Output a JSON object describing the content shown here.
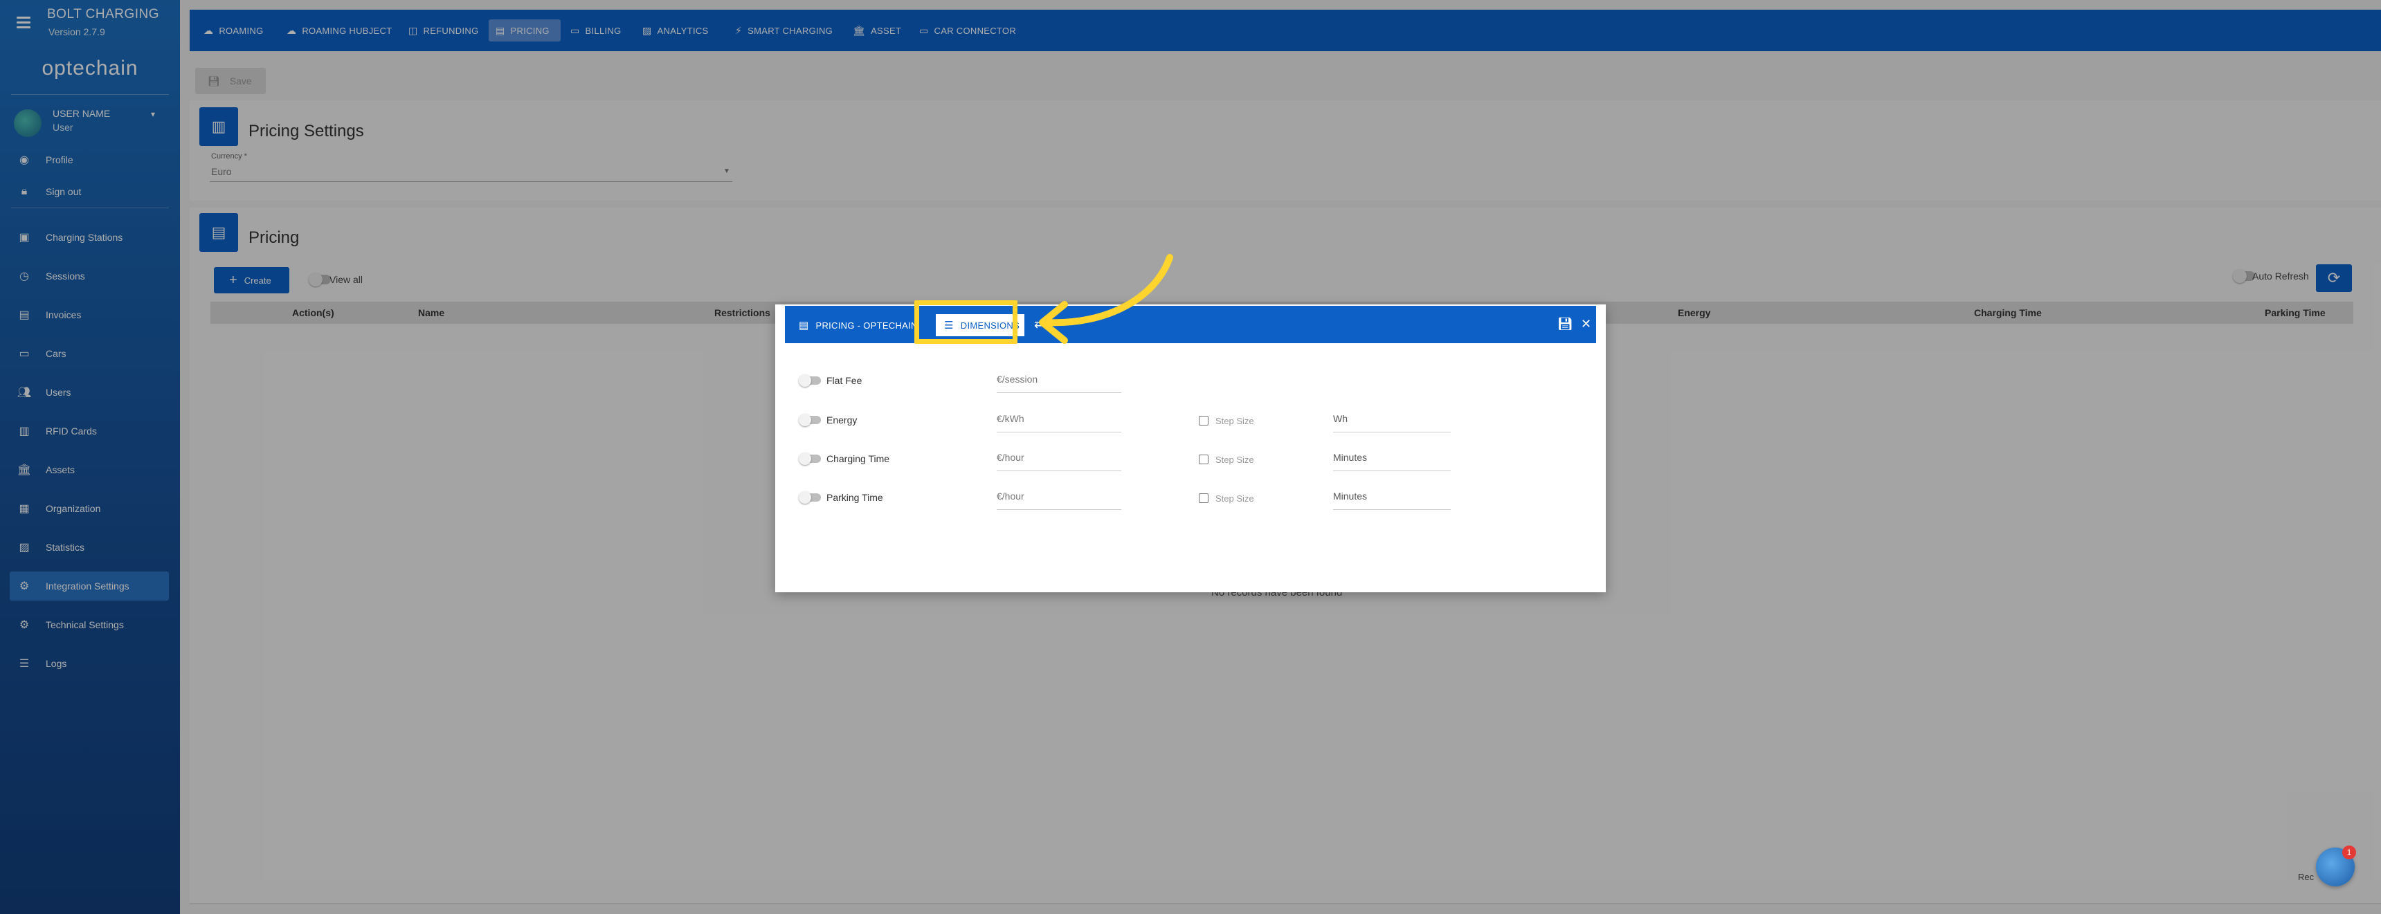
{
  "app": {
    "title": "BOLT CHARGING",
    "version": "Version 2.7.9",
    "logo": "optechain"
  },
  "user": {
    "name": "USER NAME",
    "role": "User",
    "caret": "▾"
  },
  "sidebar": {
    "account_items": [
      {
        "label": "Profile",
        "icon": "account-icon"
      },
      {
        "label": "Sign out",
        "icon": "lock-icon"
      }
    ],
    "items": [
      {
        "label": "Charging Stations",
        "icon": "ev-station-icon"
      },
      {
        "label": "Sessions",
        "icon": "history-icon"
      },
      {
        "label": "Invoices",
        "icon": "invoice-icon"
      },
      {
        "label": "Cars",
        "icon": "car-icon"
      },
      {
        "label": "Users",
        "icon": "users-icon"
      },
      {
        "label": "RFID Cards",
        "icon": "badge-icon"
      },
      {
        "label": "Assets",
        "icon": "bank-icon"
      },
      {
        "label": "Organization",
        "icon": "domain-icon"
      },
      {
        "label": "Statistics",
        "icon": "chart-icon"
      },
      {
        "label": "Integration Settings",
        "icon": "gear-icon",
        "active": true
      },
      {
        "label": "Technical Settings",
        "icon": "settings-box-icon"
      },
      {
        "label": "Logs",
        "icon": "list-icon"
      }
    ]
  },
  "topbar": {
    "tabs": [
      {
        "label": "ROAMING",
        "icon": "cloud-icon"
      },
      {
        "label": "ROAMING HUBJECT",
        "icon": "cloud-icon"
      },
      {
        "label": "REFUNDING",
        "icon": "refund-icon"
      },
      {
        "label": "PRICING",
        "icon": "pricing-icon",
        "active": true
      },
      {
        "label": "BILLING",
        "icon": "credit-card-icon"
      },
      {
        "label": "ANALYTICS",
        "icon": "analytics-icon"
      },
      {
        "label": "SMART CHARGING",
        "icon": "bolt-icon"
      },
      {
        "label": "ASSET",
        "icon": "bank-icon"
      },
      {
        "label": "CAR CONNECTOR",
        "icon": "car-icon"
      }
    ]
  },
  "toolbar": {
    "save_label": "Save"
  },
  "pricing_settings": {
    "title": "Pricing Settings",
    "currency_label": "Currency *",
    "currency_value": "Euro"
  },
  "pricing": {
    "title": "Pricing",
    "create_label": "Create",
    "view_all_label": "View all",
    "auto_refresh_label": "Auto Refresh",
    "columns": {
      "actions": "Action(s)",
      "name": "Name",
      "restrictions": "Restrictions",
      "energy": "Energy",
      "charging_time": "Charging Time",
      "parking_time": "Parking Time"
    },
    "empty_message": "No records have been found",
    "records_label": "Rec"
  },
  "dialog": {
    "tab_main": "PRICING - OPTECHAIN",
    "tab_dimensions": "DIMENSIONS",
    "rows": [
      {
        "label": "Flat Fee",
        "placeholder": "€/session",
        "has_step": false
      },
      {
        "label": "Energy",
        "placeholder": "€/kWh",
        "has_step": true,
        "step_label": "Step Size",
        "unit": "Wh"
      },
      {
        "label": "Charging Time",
        "placeholder": "€/hour",
        "has_step": true,
        "step_label": "Step Size",
        "unit": "Minutes"
      },
      {
        "label": "Parking Time",
        "placeholder": "€/hour",
        "has_step": true,
        "step_label": "Step Size",
        "unit": "Minutes"
      }
    ]
  },
  "chat": {
    "badge_count": "1"
  },
  "colors": {
    "primary": "#0d61c6",
    "highlight": "#ffd42e",
    "sidebar": "#1a5ea9"
  }
}
